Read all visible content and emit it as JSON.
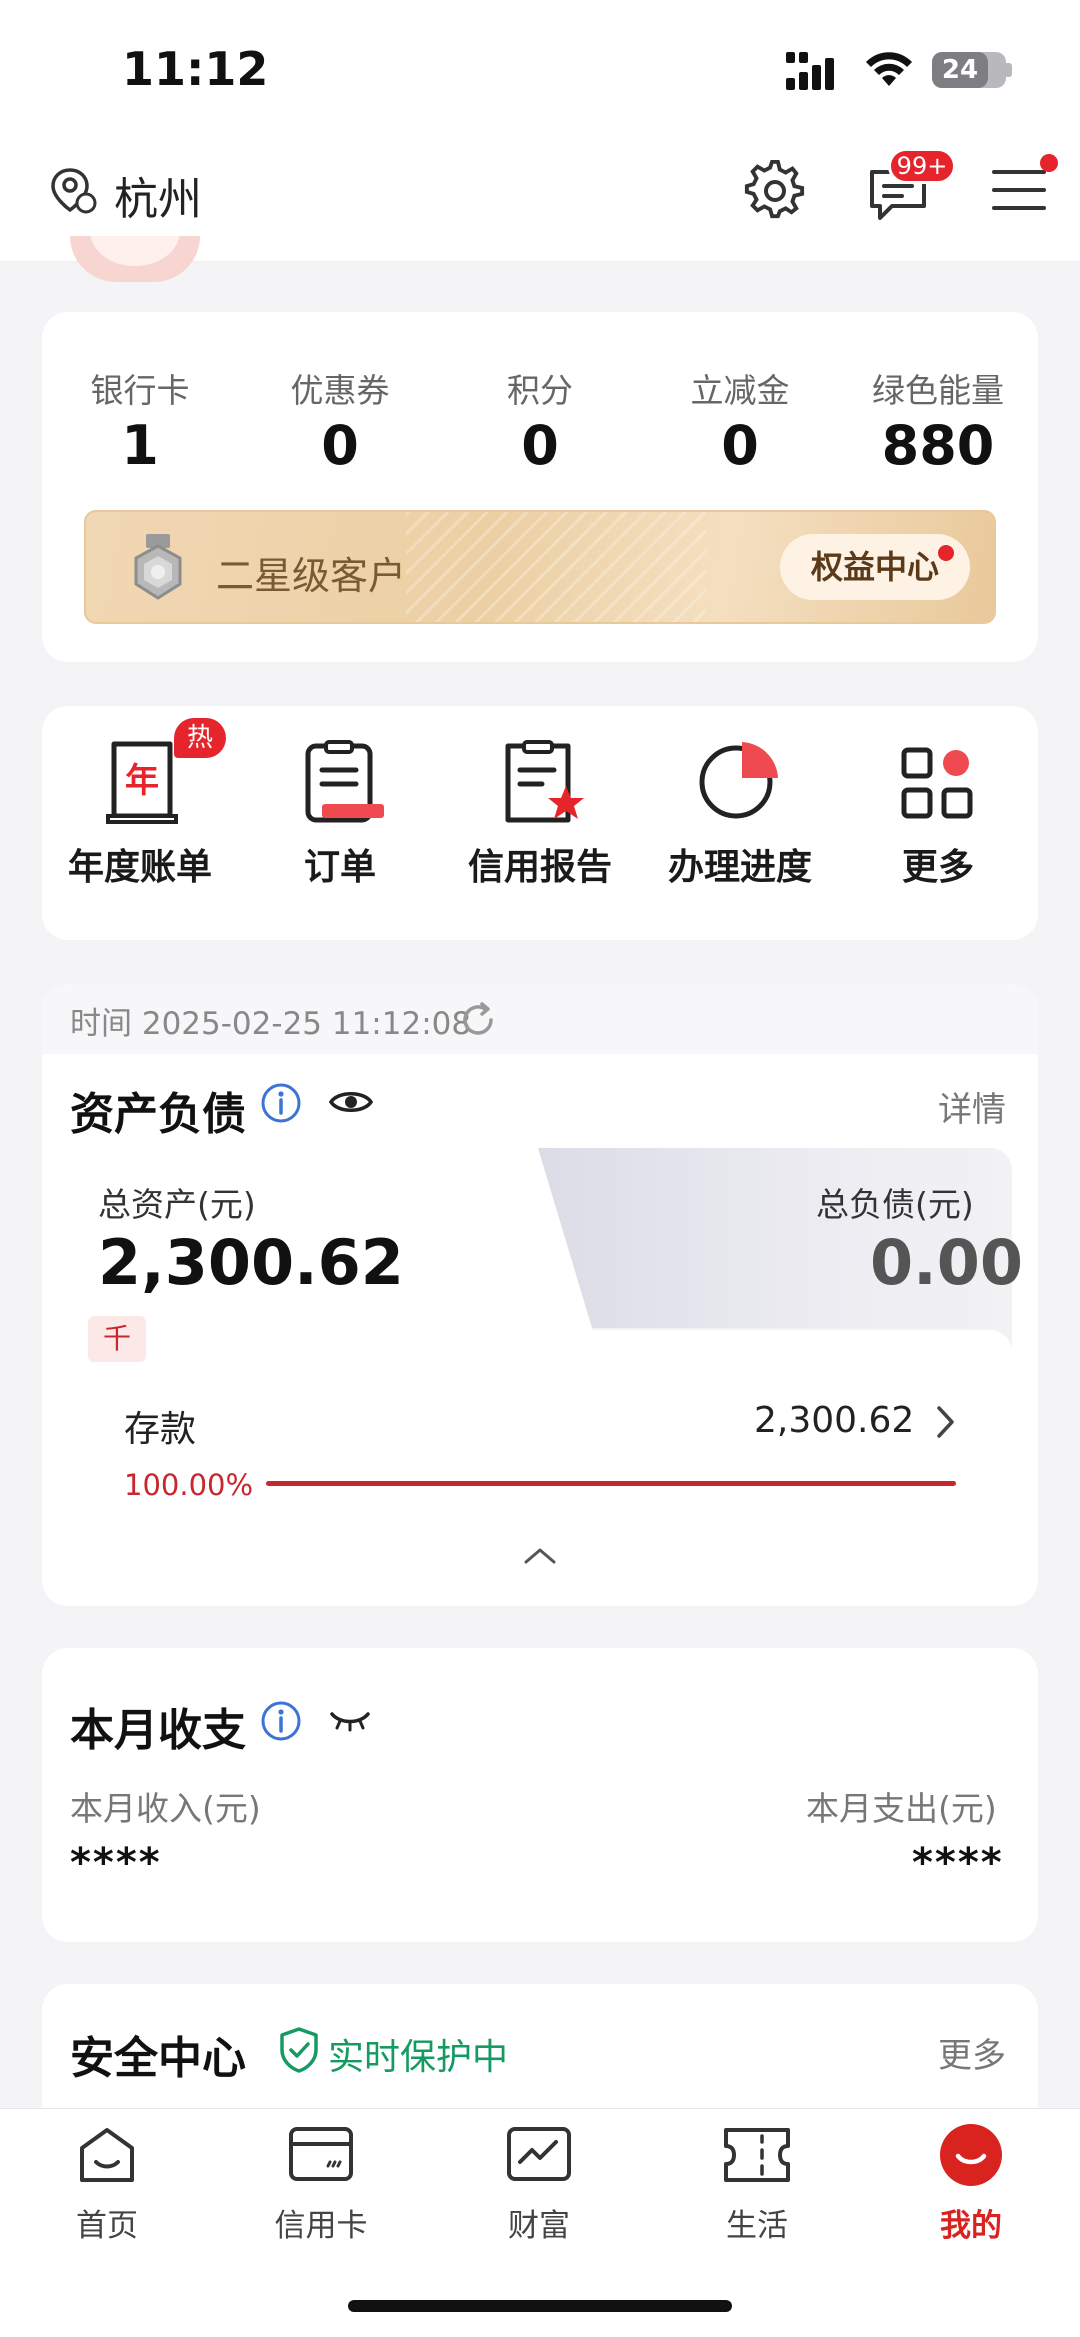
{
  "status_bar": {
    "time": "11:12",
    "battery": "24"
  },
  "header": {
    "city": "杭州",
    "message_badge": "99+"
  },
  "stats": [
    {
      "label": "银行卡",
      "value": "1"
    },
    {
      "label": "优惠券",
      "value": "0"
    },
    {
      "label": "积分",
      "value": "0"
    },
    {
      "label": "立减金",
      "value": "0"
    },
    {
      "label": "绿色能量",
      "value": "880"
    }
  ],
  "level": {
    "name": "二星级客户",
    "button": "权益中心"
  },
  "functions": [
    {
      "label": "年度账单",
      "icon": "annual-bill-icon",
      "badge": "热",
      "glyph": "年"
    },
    {
      "label": "订单",
      "icon": "order-icon"
    },
    {
      "label": "信用报告",
      "icon": "credit-report-icon"
    },
    {
      "label": "办理进度",
      "icon": "progress-icon"
    },
    {
      "label": "更多",
      "icon": "more-grid-icon"
    }
  ],
  "assets": {
    "time_label": "时间 2025-02-25 11:12:08",
    "title": "资产负债",
    "detail": "详情",
    "total_assets_label": "总资产(元)",
    "total_assets_value": "2,300.62",
    "total_liabilities_label": "总负债(元)",
    "total_liabilities_value": "0.00",
    "unit_tag": "千",
    "deposit_label": "存款",
    "deposit_value": "2,300.62",
    "deposit_percent": "100.00%"
  },
  "monthly": {
    "title": "本月收支",
    "income_label": "本月收入(元)",
    "income_value": "****",
    "expense_label": "本月支出(元)",
    "expense_value": "****"
  },
  "security": {
    "title": "安全中心",
    "status": "实时保护中",
    "more": "更多"
  },
  "tabs": [
    {
      "label": "首页",
      "icon": "home-icon"
    },
    {
      "label": "信用卡",
      "icon": "credit-card-icon"
    },
    {
      "label": "财富",
      "icon": "wealth-chart-icon"
    },
    {
      "label": "生活",
      "icon": "ticket-icon"
    },
    {
      "label": "我的",
      "icon": "profile-icon",
      "active": true
    }
  ],
  "colors": {
    "brand_red": "#d9231f",
    "safe_green": "#159b62",
    "gold": "#ecd0a4"
  }
}
